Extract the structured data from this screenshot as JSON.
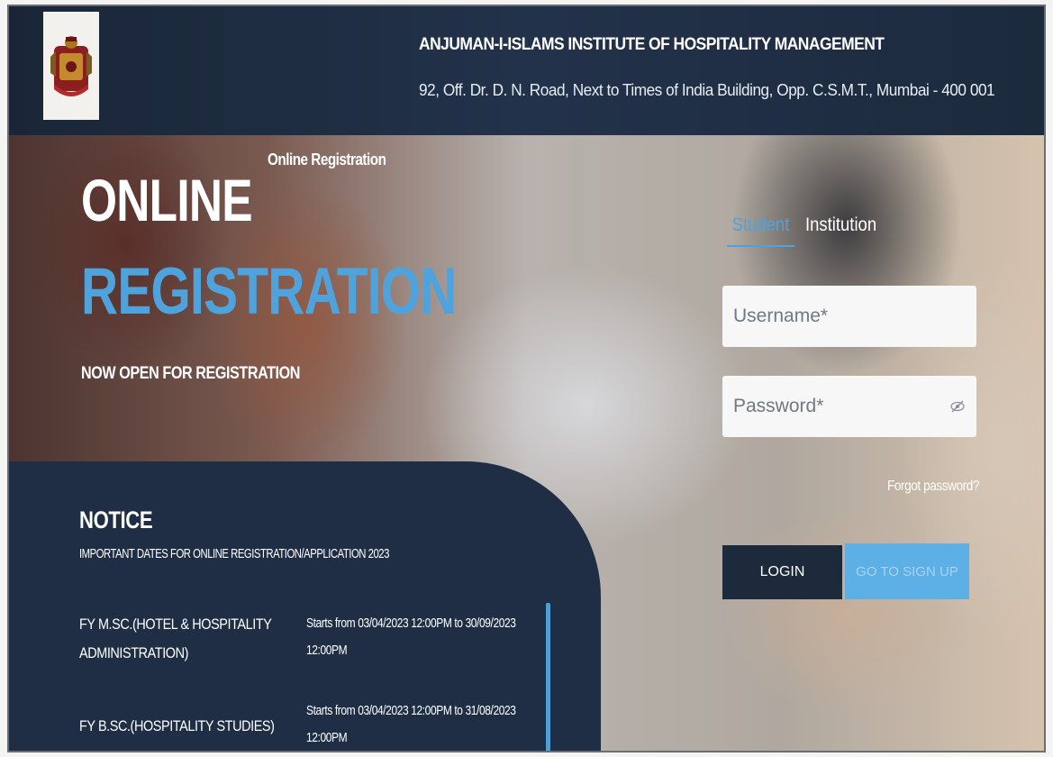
{
  "header": {
    "institute_name": "ANJUMAN-I-ISLAMS INSTITUTE OF HOSPITALITY MANAGEMENT",
    "address": "92, Off. Dr. D. N. Road, Next to Times of India Building, Opp. C.S.M.T., Mumbai - 400 001",
    "logo_icon": "institute-crest-icon"
  },
  "hero": {
    "small_label": "Online Registration",
    "headline_line1": "ONLINE",
    "headline_line2": "REGISTRATION",
    "subtext": "NOW OPEN FOR REGISTRATION"
  },
  "login": {
    "tabs": [
      {
        "label": "Student",
        "active": true
      },
      {
        "label": "Institution",
        "active": false
      }
    ],
    "username_placeholder": "Username*",
    "password_placeholder": "Password*",
    "forgot_password": "Forgot password?",
    "login_label": "LOGIN",
    "signup_label": "GO TO SIGN UP"
  },
  "notice": {
    "title": "NOTICE",
    "subtitle": "IMPORTANT DATES FOR ONLINE REGISTRATION/APPLICATION 2023",
    "items": [
      {
        "course_line1": "FY M.SC.(HOTEL & HOSPITALITY",
        "course_line2": "ADMINISTRATION)",
        "dates_line1": "Starts from 03/04/2023 12:00PM to 30/09/2023",
        "dates_line2": "12:00PM"
      },
      {
        "course_line1": "FY B.SC.(HOSPITALITY STUDIES)",
        "dates_line1": "Starts from 03/04/2023 12:00PM to 31/08/2023",
        "dates_line2": "12:00PM"
      }
    ]
  },
  "colors": {
    "accent": "#4fa3dc",
    "header_bg": "#1a2638",
    "notice_bg": "#1f2e44",
    "login_button": "#1d2a3c",
    "signup_button": "#5db0e6"
  }
}
